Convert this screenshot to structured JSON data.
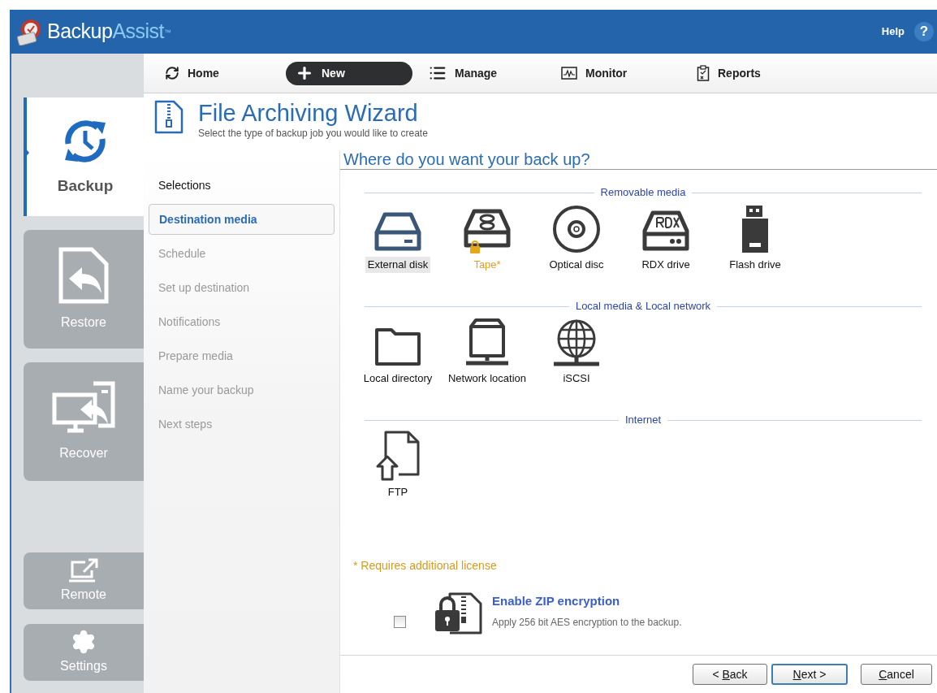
{
  "app": {
    "brand_main": "Backup",
    "brand_accent": "Assist",
    "brand_mark": "™",
    "help": "Help",
    "help_icon": "?"
  },
  "sidebar": [
    {
      "label": "Backup",
      "kind": "large",
      "selected": true
    },
    {
      "label": "Restore",
      "kind": "large",
      "selected": false
    },
    {
      "label": "Recover",
      "kind": "large",
      "selected": false
    },
    {
      "label": "Remote",
      "kind": "small",
      "selected": false
    },
    {
      "label": "Settings",
      "kind": "small",
      "selected": false
    }
  ],
  "nav": [
    {
      "label": "Home",
      "selected": false
    },
    {
      "label": "New",
      "selected": true
    },
    {
      "label": "Manage",
      "selected": false
    },
    {
      "label": "Monitor",
      "selected": false
    },
    {
      "label": "Reports",
      "selected": false
    }
  ],
  "wizard": {
    "title": "File Archiving Wizard",
    "subtitle": "Select the type of backup job you would like to create"
  },
  "steps": [
    {
      "label": "Selections",
      "selected": false,
      "disabled": false
    },
    {
      "label": "Destination media",
      "selected": true,
      "disabled": false
    },
    {
      "label": "Schedule",
      "selected": false,
      "disabled": true
    },
    {
      "label": "Set up destination",
      "selected": false,
      "disabled": true
    },
    {
      "label": "Notifications",
      "selected": false,
      "disabled": true
    },
    {
      "label": "Prepare media",
      "selected": false,
      "disabled": true
    },
    {
      "label": "Name your backup",
      "selected": false,
      "disabled": true
    },
    {
      "label": "Next steps",
      "selected": false,
      "disabled": true
    }
  ],
  "question": "Where do you want your back up?",
  "sections": [
    {
      "title": "Removable media",
      "options": [
        {
          "label": "External disk",
          "selected": true,
          "requires_license": false
        },
        {
          "label": "Tape*",
          "selected": false,
          "requires_license": true
        },
        {
          "label": "Optical disc",
          "selected": false,
          "requires_license": false
        },
        {
          "label": "RDX drive",
          "selected": false,
          "requires_license": false
        },
        {
          "label": "Flash drive",
          "selected": false,
          "requires_license": false
        }
      ]
    },
    {
      "title": "Local media & Local network",
      "options": [
        {
          "label": "Local directory",
          "selected": false,
          "requires_license": false
        },
        {
          "label": "Network location",
          "selected": false,
          "requires_license": false
        },
        {
          "label": "iSCSI",
          "selected": false,
          "requires_license": false
        }
      ]
    },
    {
      "title": "Internet",
      "options": [
        {
          "label": "FTP",
          "selected": false,
          "requires_license": false
        }
      ]
    }
  ],
  "license_note": "* Requires additional license",
  "zip": {
    "title": "Enable ZIP encryption",
    "description": "Apply 256 bit AES encryption to the backup.",
    "checked": false
  },
  "buttons": [
    {
      "before": "< ",
      "key": "B",
      "after": "ack",
      "default": false
    },
    {
      "key": "N",
      "after": "ext >",
      "default": true
    },
    {
      "key": "C",
      "after": "ancel",
      "default": false
    }
  ]
}
